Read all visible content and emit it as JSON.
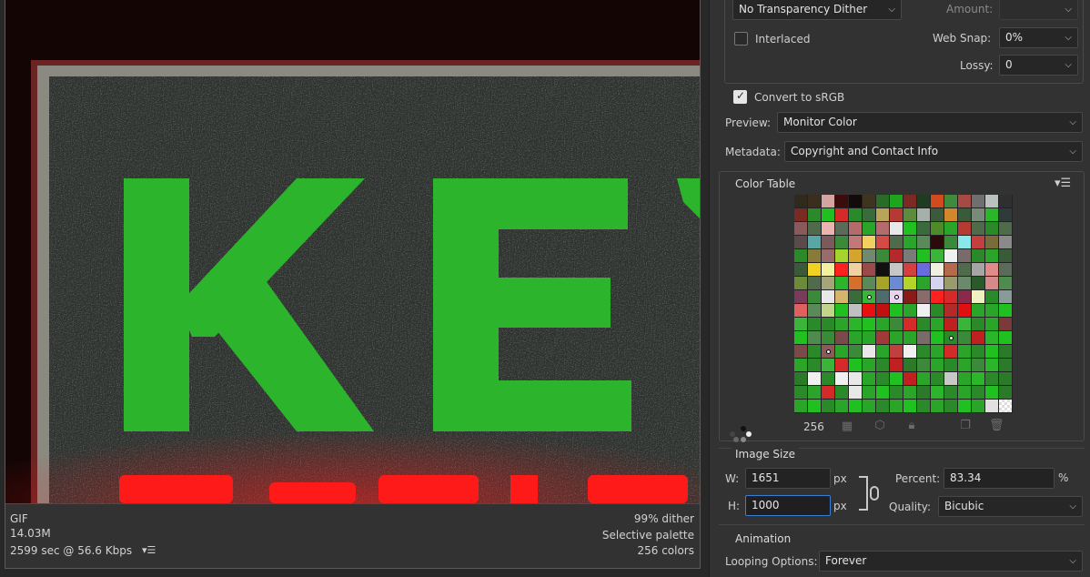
{
  "preview": {
    "image_text_top": "KEY",
    "format": "GIF",
    "file_size": "14.03M",
    "download_time": "2599 sec @ 56.6 Kbps",
    "dither": "99% dither",
    "palette": "Selective palette",
    "colors": "256 colors"
  },
  "settings": {
    "transparency_dither": "No Transparency Dither",
    "amount_label": "Amount:",
    "amount_value": "",
    "interlaced_label": "Interlaced",
    "interlaced_checked": false,
    "web_snap_label": "Web Snap:",
    "web_snap_value": "0%",
    "lossy_label": "Lossy:",
    "lossy_value": "0",
    "convert_srgb_label": "Convert to sRGB",
    "convert_srgb_checked": true,
    "preview_label": "Preview:",
    "preview_value": "Monitor Color",
    "metadata_label": "Metadata:",
    "metadata_value": "Copyright and Contact Info"
  },
  "color_table": {
    "title": "Color Table",
    "count": "256",
    "colors": [
      "#2f2a1c",
      "#3b2e1e",
      "#d4a5a0",
      "#3a0d0c",
      "#120b0a",
      "#3f3420",
      "#2a6b2a",
      "#1ea51e",
      "#7a2a22",
      "#1f3b22",
      "#d24b1e",
      "#3f8a3b",
      "#a84a44",
      "#6f6f6f",
      "#b9c2bd",
      "#2f2f2f",
      "#7a2a22",
      "#2a8a2a",
      "#20c020",
      "#d42a2a",
      "#2a8a2a",
      "#3a6b3a",
      "#b9a55a",
      "#b53a34",
      "#5b8b3b",
      "#a5b0aa",
      "#3a5a3a",
      "#d4862a",
      "#3a5b3a",
      "#7a8a7a",
      "#2ab52a",
      "#2f3a3a",
      "#8a5a5a",
      "#4f6b4b",
      "#ecb4b0",
      "#5a6b5a",
      "#b56b6b",
      "#2aa52a",
      "#b56b6b",
      "#e8e8e8",
      "#20c020",
      "#3a6b3a",
      "#4f8a2a",
      "#2aa52a",
      "#b53a34",
      "#4f6b4b",
      "#2a8a2a",
      "#4f6b4b",
      "#5a4a4a",
      "#5aa5a5",
      "#7a5a5a",
      "#3a8a3a",
      "#c07878",
      "#f0d060",
      "#d44a44",
      "#4f6b4b",
      "#2aa52a",
      "#5a8a5a",
      "#2a0a0a",
      "#3a8a3a",
      "#8ae8e8",
      "#c44040",
      "#7a6b3a",
      "#8a8a8a",
      "#2a8a2a",
      "#8a7a3a",
      "#9a6b6b",
      "#a5d42a",
      "#d4a52a",
      "#6f8a6f",
      "#3a8a3a",
      "#b42a2a",
      "#7a7a7a",
      "#20c020",
      "#3ab53a",
      "#f0f0f0",
      "#7a6b6b",
      "#2a8a2a",
      "#2aa52a",
      "#3a5a3a",
      "#3a5a3a",
      "#f0d020",
      "#f0f0a0",
      "#ff2020",
      "#f0d0a0",
      "#9a4a4a",
      "#101010",
      "#c6c6c6",
      "#d44040",
      "#6a6adf",
      "#f0f0e0",
      "#b56b4b",
      "#4f6b4b",
      "#a5a5a5",
      "#e08a8a",
      "#5a6b5a",
      "#6b8a3a",
      "#4f6b4b",
      "#a5a57a",
      "#2ab52a",
      "#d4702a",
      "#5a8a5a",
      "#a5a52a",
      "#6b8ad4",
      "#b5d42a",
      "#2aa52a",
      "#d4d4f0",
      "#9a9a6b",
      "#6b8a6b",
      "#2a5a2a",
      "#d48a8a",
      "#4f8a4f",
      "#7a3a5a",
      "#3a8a3a",
      "#e8e8e8",
      "#d4b56b",
      "#3a6b3a",
      "#3ab53a",
      "#4f6b6b",
      "#e8d4f0",
      "#8a1a1a",
      "#8a6b6b",
      "#ff2020",
      "#d42a2a",
      "#8a2a4a",
      "#f0f0c0",
      "#2a8a2a",
      "#8a9a9a",
      "#e06060",
      "#5a8a5a",
      "#c0d48a",
      "#20c020",
      "#c0c0c0",
      "#e81010",
      "#c01010",
      "#20c020",
      "#2aa52a",
      "#f0f0f0",
      "#2a8a2a",
      "#b42a2a",
      "#e01010",
      "#2aa52a",
      "#2aa52a",
      "#20c020",
      "#3ab53a",
      "#2a8a2a",
      "#2a8a2a",
      "#2aa52a",
      "#2ab52a",
      "#20c020",
      "#2aa52a",
      "#3a8a3a",
      "#d42a2a",
      "#2a8a2a",
      "#2aa52a",
      "#c02020",
      "#3ab53a",
      "#2a8a2a",
      "#2aa52a",
      "#7a3a3a",
      "#20c020",
      "#4f8a4f",
      "#3a8a3a",
      "#7a4a4a",
      "#2aa52a",
      "#2aa52a",
      "#a03a3a",
      "#2aa52a",
      "#2aa52a",
      "#7a6b6b",
      "#20c020",
      "#2a8a2a",
      "#3a8a3a",
      "#c02020",
      "#2ab52a",
      "#20c020",
      "#7a4a4a",
      "#2a8a2a",
      "#8a5a5a",
      "#2aa52a",
      "#3a8a3a",
      "#e8e8e8",
      "#2aa52a",
      "#c04040",
      "#f0f0f0",
      "#2a8a2a",
      "#2aa52a",
      "#d42a2a",
      "#2aa52a",
      "#2a8a2a",
      "#20c020",
      "#2a7a2a",
      "#2aa52a",
      "#2a8a2a",
      "#3ab53a",
      "#d42a2a",
      "#20c020",
      "#2aa52a",
      "#2a8a2a",
      "#c02020",
      "#2a7a2a",
      "#3a8a3a",
      "#2aa52a",
      "#2a8a2a",
      "#2aa52a",
      "#3a8a3a",
      "#2ab52a",
      "#2a7a2a",
      "#2a7a2a",
      "#f0f0f0",
      "#2a8a2a",
      "#f0f0f0",
      "#e8e8e8",
      "#2aa52a",
      "#2a8a2a",
      "#20c020",
      "#c02020",
      "#2aa52a",
      "#2a8a2a",
      "#c8c8c8",
      "#2aa52a",
      "#2ab52a",
      "#2a8a2a",
      "#2a7a2a",
      "#2a8a2a",
      "#2aa52a",
      "#d42a2a",
      "#2a8a2a",
      "#e8e8e8",
      "#2aa52a",
      "#20c020",
      "#2a8a2a",
      "#2aa52a",
      "#2a7a2a",
      "#2ab52a",
      "#2a8a2a",
      "#2aa52a",
      "#2a8a2a",
      "#20c020",
      "#2a7a2a",
      "#2aa52a",
      "#20c020",
      "#2a8a2a",
      "#2aa52a",
      "#20c020",
      "#2aa52a",
      "#2a8a2a",
      "#2aa52a",
      "#20c020",
      "#2a8a2a",
      "#2aa52a",
      "#2a8a2a",
      "#20c020",
      "#2aa52a",
      "#e0e0e0",
      "#2a8a2a"
    ],
    "marked": [
      117,
      119,
      171,
      178
    ],
    "tools": [
      "web-shift-icon",
      "web-snap-cube-icon",
      "lock-color-icon",
      "new-color-icon",
      "delete-color-icon"
    ]
  },
  "image_size": {
    "title": "Image Size",
    "width_label": "W:",
    "width_value": "1651",
    "width_unit": "px",
    "height_label": "H:",
    "height_value": "1000",
    "height_unit": "px",
    "percent_label": "Percent:",
    "percent_value": "83.34",
    "percent_unit": "%",
    "quality_label": "Quality:",
    "quality_value": "Bicubic"
  },
  "animation": {
    "title": "Animation",
    "looping_label": "Looping Options:",
    "looping_value": "Forever"
  },
  "colors": {
    "accent": "#3a7ed1",
    "letters": "#2cb52c",
    "neon_red": "#ff1a1a"
  }
}
